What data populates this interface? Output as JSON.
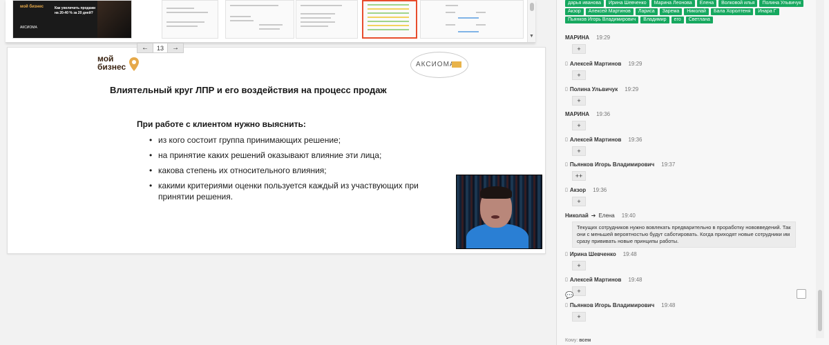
{
  "thumbnails": {
    "thumb1": {
      "logo": "мой бизнес",
      "title": "Как увеличить продажи на 20-40 % за 20 дней?",
      "brand": "АКСИОМА"
    }
  },
  "pager": {
    "prev_icon": "←",
    "page": "13",
    "next_icon": "→"
  },
  "slide": {
    "logo_left_line1": "мой",
    "logo_left_line2": "бизнес",
    "logo_right": "АКСИОМА",
    "title": "Влиятельный круг ЛПР и его воздействия на процесс продаж",
    "subtitle": "При работе с клиентом нужно выяснить:",
    "bullets": [
      "из кого состоит группа принимающих решение;",
      "на принятие каких решений оказывают влияние эти лица;",
      "какова степень их относительного влияния;",
      "какими критериями оценки пользуется каждый из участвующих при принятии решения."
    ]
  },
  "video": {
    "label": "video-participant"
  },
  "participants": [
    "дарья иванова",
    "Ирина Шевченко",
    "Марина Леонова",
    "Елена",
    "Волковой илья",
    "Полина Ульвичук",
    "Акзор",
    "Алексей Мартинов",
    "Лариса",
    "Зарема",
    "Николай",
    "Бала Хоролтеня",
    "Инара Г",
    "Пьянков Игорь Владимирович",
    "Владимир",
    "его",
    "Светлана"
  ],
  "chat": {
    "messages": [
      {
        "author": "МАРИНА",
        "time": "19:29",
        "plus": "+"
      },
      {
        "author": "Алексей Мартинов",
        "time": "19:29",
        "plus": "+"
      },
      {
        "author": "Полина Ульвичук",
        "time": "19:29",
        "plus": "+"
      },
      {
        "author": "МАРИНА",
        "time": "19:36",
        "plus": "+"
      },
      {
        "author": "Алексей Мартинов",
        "time": "19:36",
        "plus": "+"
      },
      {
        "author": "Пьянков Игорь Владимирович",
        "time": "19:37",
        "plus": "++"
      },
      {
        "author": "Акзор",
        "time": "19:36",
        "plus": "+"
      },
      {
        "author": "Николай",
        "recipient": "Елена",
        "time": "19:40",
        "text": "Текущих сотрудников нужно вовлекать предварительно в проработку нововведений. Так они с меньшей вероятностью будут саботировать. Когда приходят новые сотрудники им сразу прививать новые принципы работы."
      },
      {
        "author": "Ирина Шевченко",
        "time": "19:48",
        "plus": "+"
      },
      {
        "author": "Алексей Мартинов",
        "time": "19:48",
        "plus": "+"
      },
      {
        "author": "Пьянков Игорь Владимирович",
        "time": "19:48",
        "plus": "+"
      }
    ],
    "to_label": "Кому:",
    "to_value": "всем"
  },
  "colors": {
    "chip_green": "#16a85f",
    "accent_red": "#e74c2c"
  }
}
